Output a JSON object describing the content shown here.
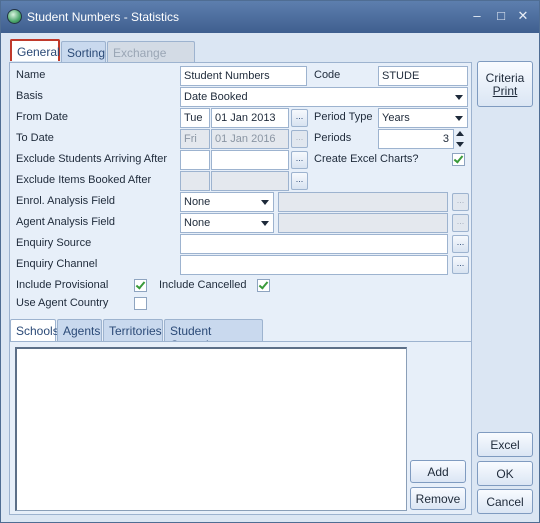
{
  "window": {
    "title": "Student Numbers - Statistics",
    "controls": {
      "minimize": "–",
      "maximize": "□",
      "close": "✕"
    }
  },
  "tabs": [
    {
      "label": "General",
      "state": "active"
    },
    {
      "label": "Sorting",
      "state": "normal"
    },
    {
      "label": "Exchange Rates",
      "state": "disabled"
    }
  ],
  "form": {
    "name": {
      "label": "Name",
      "value": "Student Numbers"
    },
    "code": {
      "label": "Code",
      "value": "STUDE"
    },
    "basis": {
      "label": "Basis",
      "value": "Date Booked"
    },
    "from_date": {
      "label": "From Date",
      "day": "Tue",
      "value": "01 Jan 2013"
    },
    "period_type": {
      "label": "Period Type",
      "value": "Years"
    },
    "to_date": {
      "label": "To Date",
      "day": "Fri",
      "value": "01 Jan 2016"
    },
    "periods": {
      "label": "Periods",
      "value": "3"
    },
    "exclude_arriving": {
      "label": "Exclude Students Arriving After",
      "day": "",
      "value": ""
    },
    "create_excel_charts": {
      "label": "Create Excel Charts?",
      "checked": true
    },
    "exclude_booked": {
      "label": "Exclude Items Booked After",
      "day": "",
      "value": ""
    },
    "enrol_analysis": {
      "label": "Enrol. Analysis Field",
      "value": "None"
    },
    "agent_analysis": {
      "label": "Agent Analysis Field",
      "value": "None"
    },
    "enquiry_source": {
      "label": "Enquiry Source",
      "value": ""
    },
    "enquiry_channel": {
      "label": "Enquiry Channel",
      "value": ""
    },
    "include_provisional": {
      "label": "Include Provisional",
      "checked": true
    },
    "include_cancelled": {
      "label": "Include Cancelled",
      "checked": true
    },
    "use_agent_country": {
      "label": "Use Agent Country",
      "checked": false
    },
    "ellipsis": "..."
  },
  "lower_tabs": [
    {
      "label": "Schools",
      "state": "active"
    },
    {
      "label": "Agents",
      "state": "normal"
    },
    {
      "label": "Territories",
      "state": "normal"
    },
    {
      "label": "Student Countries",
      "state": "normal"
    }
  ],
  "list_buttons": {
    "add": "Add",
    "remove": "Remove"
  },
  "side_buttons": {
    "criteria_print_line1": "Criteria",
    "criteria_print_line2": "Print",
    "excel": "Excel",
    "ok": "OK",
    "cancel": "Cancel"
  },
  "colors": {
    "title_bar": "#4a6a9a",
    "body_bg": "#dbe6f3",
    "check_green": "#3a9a3a",
    "focus_red": "#c0392b"
  }
}
